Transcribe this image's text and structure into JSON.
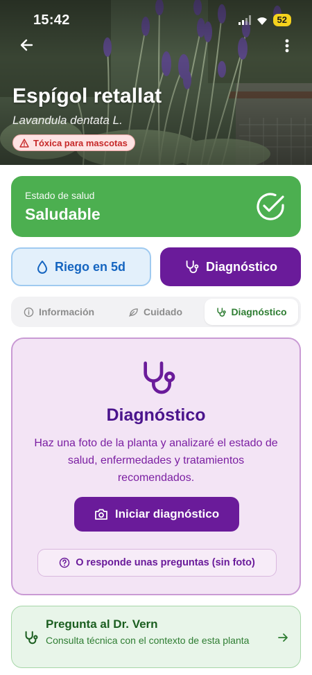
{
  "status_bar": {
    "time": "15:42",
    "battery": "52"
  },
  "plant": {
    "name": "Espígol retallat",
    "scientific_name": "Lavandula dentata L.",
    "toxicity_badge": "Tóxica para mascotas"
  },
  "health": {
    "label": "Estado de salud",
    "value": "Saludable"
  },
  "actions": {
    "water_label": "Riego en 5d",
    "diagnosis_label": "Diagnóstico"
  },
  "tabs": [
    {
      "label": "Información",
      "icon": "info-icon",
      "active": false
    },
    {
      "label": "Cuidado",
      "icon": "leaf-icon",
      "active": false
    },
    {
      "label": "Diagnóstico",
      "icon": "stethoscope-icon",
      "active": true
    }
  ],
  "diagnosis_panel": {
    "title": "Diagnóstico",
    "description": "Haz una foto de la planta y analizaré el estado de salud, enfermedades y tratamientos recomendados.",
    "start_button": "Iniciar diagnóstico",
    "questions_button": "O responde unas preguntas (sin foto)"
  },
  "ask_vern": {
    "title": "Pregunta al Dr. Vern",
    "description": "Consulta técnica con el contexto de esta planta"
  },
  "colors": {
    "health_green": "#4caf50",
    "diagnosis_purple": "#6a1b9a",
    "water_blue": "#1565c0",
    "toxic_red": "#c62828",
    "vern_green": "#1b5e20"
  }
}
